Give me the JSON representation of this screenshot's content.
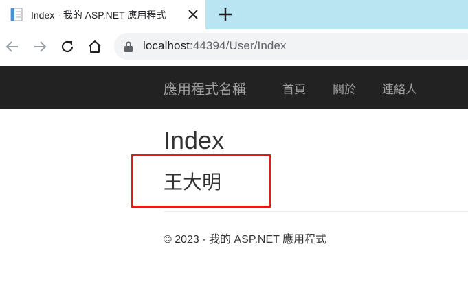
{
  "browser": {
    "tab": {
      "title": "Index - 我的 ASP.NET 應用程式"
    },
    "address": {
      "host": "localhost",
      "path": ":44394/User/Index"
    }
  },
  "navbar": {
    "brand": "應用程式名稱",
    "links": [
      "首頁",
      "關於",
      "連絡人"
    ]
  },
  "main": {
    "title": "Index",
    "user_name": "王大明"
  },
  "footer": {
    "text": "© 2023 - 我的 ASP.NET 應用程式"
  },
  "colors": {
    "tabstrip": "#b9e4f1",
    "navbar": "#222222",
    "nav_text": "#9d9d9d",
    "highlight": "#e31c1c"
  }
}
